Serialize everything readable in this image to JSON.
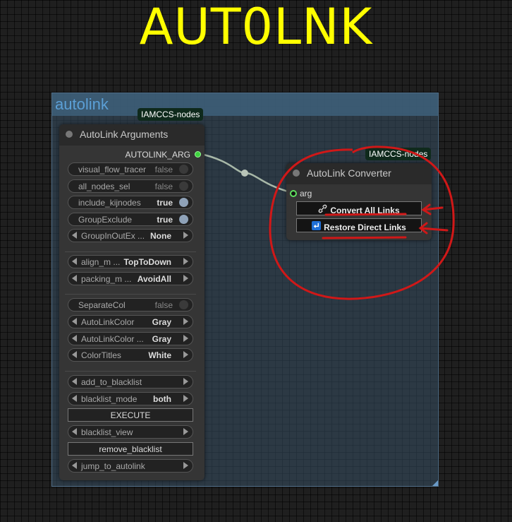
{
  "banner": {
    "title": "AUT0LNK"
  },
  "group": {
    "title": "autolink"
  },
  "args_node": {
    "badge": "IAMCCS-nodes",
    "title": "AutoLink Arguments",
    "output_label": "AUTOLINK_ARG",
    "toggles": [
      {
        "label": "visual_flow_tracer",
        "value": "false"
      },
      {
        "label": "all_nodes_sel",
        "value": "false"
      },
      {
        "label": "include_kijnodes",
        "value": "true"
      },
      {
        "label": "GroupExclude",
        "value": "true"
      }
    ],
    "combos": {
      "group_in_out": {
        "label": "GroupInOutEx ...",
        "value": "None"
      },
      "align_mode": {
        "label": "align_m ...",
        "value": "TopToDown"
      },
      "packing_mode": {
        "label": "packing_m ...",
        "value": "AvoidAll"
      },
      "auto_link_color": {
        "label": "AutoLinkColor",
        "value": "Gray"
      },
      "auto_link_color2": {
        "label": "AutoLinkColor ...",
        "value": "Gray"
      },
      "color_titles": {
        "label": "ColorTitles",
        "value": "White"
      },
      "add_to_blacklist": {
        "label": "add_to_blacklist",
        "value": ""
      },
      "blacklist_mode": {
        "label": "blacklist_mode",
        "value": "both"
      },
      "blacklist_view": {
        "label": "blacklist_view",
        "value": ""
      },
      "jump_to_autolink": {
        "label": "jump_to_autolink",
        "value": ""
      }
    },
    "separate_col": {
      "label": "SeparateCol",
      "value": "false"
    },
    "execute_label": "EXECUTE",
    "remove_blacklist_label": "remove_blacklist"
  },
  "converter_node": {
    "badge": "IAMCCS-nodes",
    "title": "AutoLink Converter",
    "input_label": "arg",
    "convert_label": "Convert All Links",
    "restore_label": "Restore Direct Links"
  },
  "colors": {
    "banner": "#ffff00",
    "group_bg": "#364e62",
    "annotation_red": "#d01818",
    "slot_green": "#3fd13f"
  }
}
